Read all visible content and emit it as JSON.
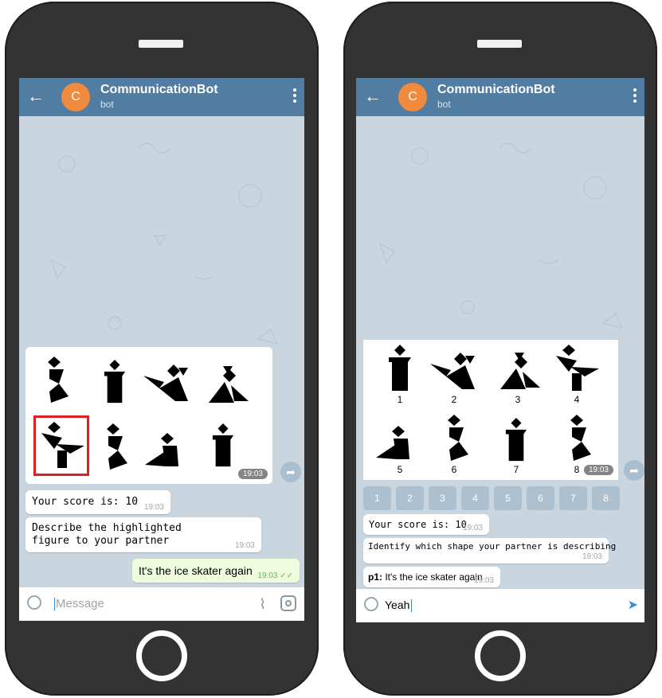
{
  "left_phone": {
    "header": {
      "back_icon": "arrow-left-icon",
      "avatar_letter": "C",
      "title": "CommunicationBot",
      "subtitle": "bot",
      "menu_icon": "more-vertical-icon"
    },
    "image_message": {
      "time": "19:03",
      "highlighted_index": 5
    },
    "messages": [
      {
        "text": "Your score is: 10",
        "time": "19:03"
      },
      {
        "text": "Describe the highlighted figure to your partner",
        "time": "19:03"
      }
    ],
    "outgoing": {
      "text": "It's the ice skater again",
      "time": "19:03",
      "status_icon": "double-check-icon"
    },
    "input": {
      "placeholder": "Message",
      "value": ""
    }
  },
  "right_phone": {
    "header": {
      "back_icon": "arrow-left-icon",
      "avatar_letter": "C",
      "title": "CommunicationBot",
      "subtitle": "bot",
      "menu_icon": "more-vertical-icon"
    },
    "image_message": {
      "time": "19:03",
      "labels": [
        "1",
        "2",
        "3",
        "4",
        "5",
        "6",
        "7",
        "8"
      ]
    },
    "keyboard": [
      "1",
      "2",
      "3",
      "4",
      "5",
      "6",
      "7",
      "8"
    ],
    "messages": [
      {
        "text": "Your score is: 10",
        "time": "19:03"
      },
      {
        "text": "Identify which shape your partner is describing",
        "time": "19:03"
      },
      {
        "sender": "p1:",
        "text": "It's the ice skater again",
        "time": "19:03"
      }
    ],
    "input": {
      "value": "Yeah"
    }
  },
  "colors": {
    "header": "#527da3",
    "chat_background": "#c9d6df",
    "avatar": "#f08a3d",
    "outgoing_bubble": "#effdde",
    "highlight": "#e02020"
  }
}
